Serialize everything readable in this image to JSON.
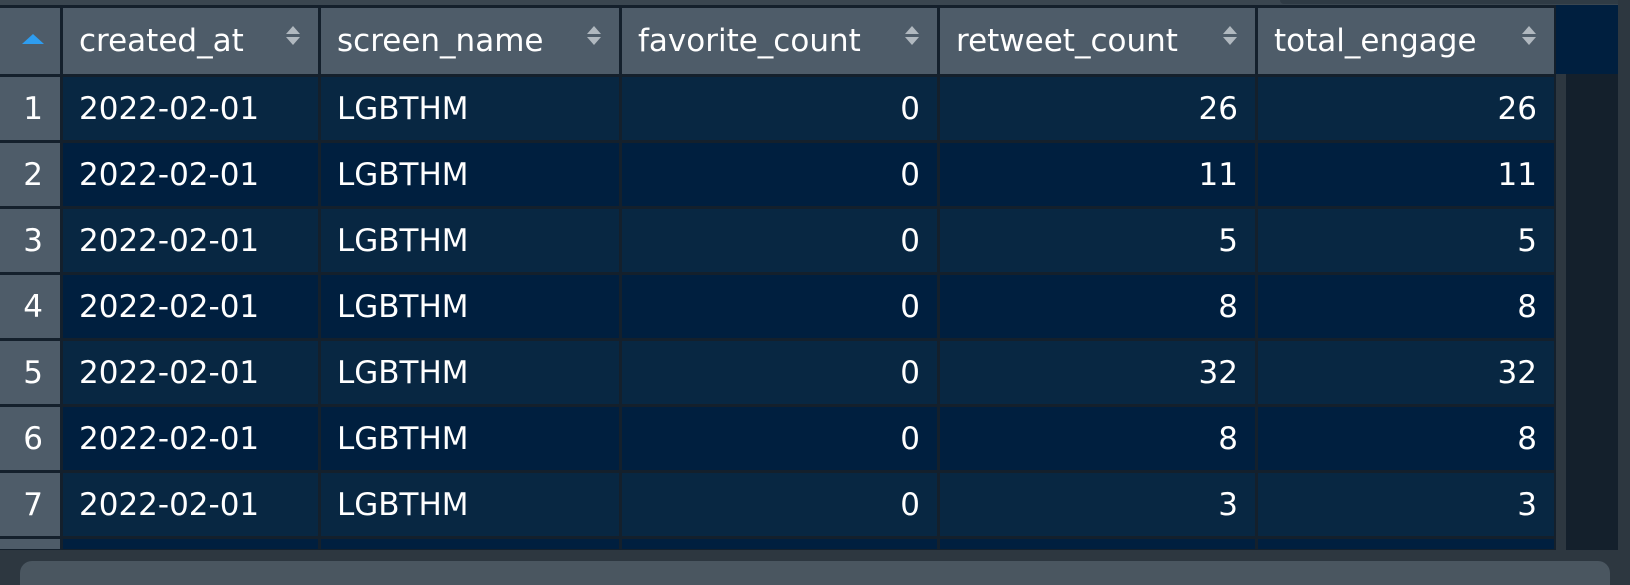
{
  "table": {
    "sort_indicator": "ascending",
    "columns": [
      {
        "key": "created_at",
        "label": "created_at",
        "align": "left"
      },
      {
        "key": "screen_name",
        "label": "screen_name",
        "align": "left"
      },
      {
        "key": "favorite_count",
        "label": "favorite_count",
        "align": "right"
      },
      {
        "key": "retweet_count",
        "label": "retweet_count",
        "align": "right"
      },
      {
        "key": "total_engage",
        "label": "total_engage",
        "align": "right"
      }
    ],
    "rows": [
      {
        "n": "1",
        "created_at": "2022-02-01",
        "screen_name": "LGBTHM",
        "favorite_count": "0",
        "retweet_count": "26",
        "total_engage": "26"
      },
      {
        "n": "2",
        "created_at": "2022-02-01",
        "screen_name": "LGBTHM",
        "favorite_count": "0",
        "retweet_count": "11",
        "total_engage": "11"
      },
      {
        "n": "3",
        "created_at": "2022-02-01",
        "screen_name": "LGBTHM",
        "favorite_count": "0",
        "retweet_count": "5",
        "total_engage": "5"
      },
      {
        "n": "4",
        "created_at": "2022-02-01",
        "screen_name": "LGBTHM",
        "favorite_count": "0",
        "retweet_count": "8",
        "total_engage": "8"
      },
      {
        "n": "5",
        "created_at": "2022-02-01",
        "screen_name": "LGBTHM",
        "favorite_count": "0",
        "retweet_count": "32",
        "total_engage": "32"
      },
      {
        "n": "6",
        "created_at": "2022-02-01",
        "screen_name": "LGBTHM",
        "favorite_count": "0",
        "retweet_count": "8",
        "total_engage": "8"
      },
      {
        "n": "7",
        "created_at": "2022-02-01",
        "screen_name": "LGBTHM",
        "favorite_count": "0",
        "retweet_count": "3",
        "total_engage": "3"
      }
    ]
  },
  "colors": {
    "header_bg": "#4e5c69",
    "row_odd_bg": "#082742",
    "row_even_bg": "#001f3f",
    "grid_line": "#14202c",
    "sort_active": "#2e9df0",
    "text": "#ffffff"
  }
}
